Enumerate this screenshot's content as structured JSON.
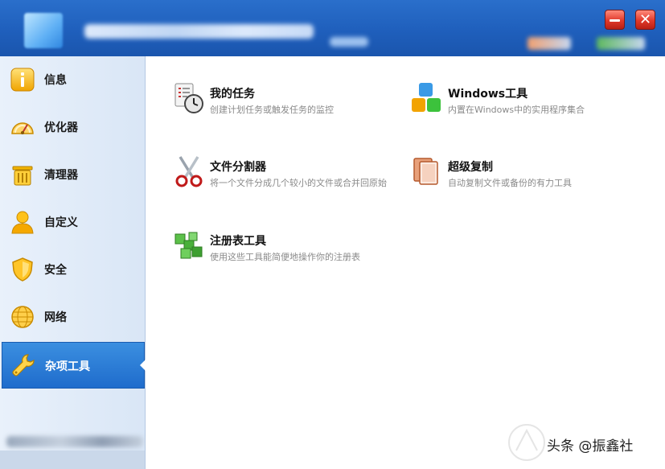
{
  "titlebar": {
    "minimize_icon": "minimize-icon",
    "close_icon": "close-icon",
    "close_glyph": "✕"
  },
  "sidebar": {
    "items": [
      {
        "label": "信息",
        "icon": "info-icon"
      },
      {
        "label": "优化器",
        "icon": "gauge-icon"
      },
      {
        "label": "清理器",
        "icon": "trash-icon"
      },
      {
        "label": "自定义",
        "icon": "user-icon"
      },
      {
        "label": "安全",
        "icon": "shield-icon"
      },
      {
        "label": "网络",
        "icon": "globe-icon"
      },
      {
        "label": "杂项工具",
        "icon": "wrench-icon",
        "active": true
      }
    ]
  },
  "tools": [
    {
      "name": "我的任务",
      "desc": "创建计划任务或触发任务的监控",
      "icon": "task-clock-icon"
    },
    {
      "name": "Windows工具",
      "desc": "内置在Windows中的实用程序集合",
      "icon": "windows-logo-icon"
    },
    {
      "name": "文件分割器",
      "desc": "将一个文件分成几个较小的文件或合并回原始",
      "icon": "scissors-icon"
    },
    {
      "name": "超级复制",
      "desc": "自动复制文件或备份的有力工具",
      "icon": "copy-icon"
    },
    {
      "name": "注册表工具",
      "desc": "使用这些工具能简便地操作你的注册表",
      "icon": "registry-cubes-icon"
    }
  ],
  "watermark": "头条 @振鑫社",
  "colors": {
    "titlebar": "#1f5fbc",
    "active_nav": "#2a7bd6",
    "close_button": "#e0392b"
  }
}
